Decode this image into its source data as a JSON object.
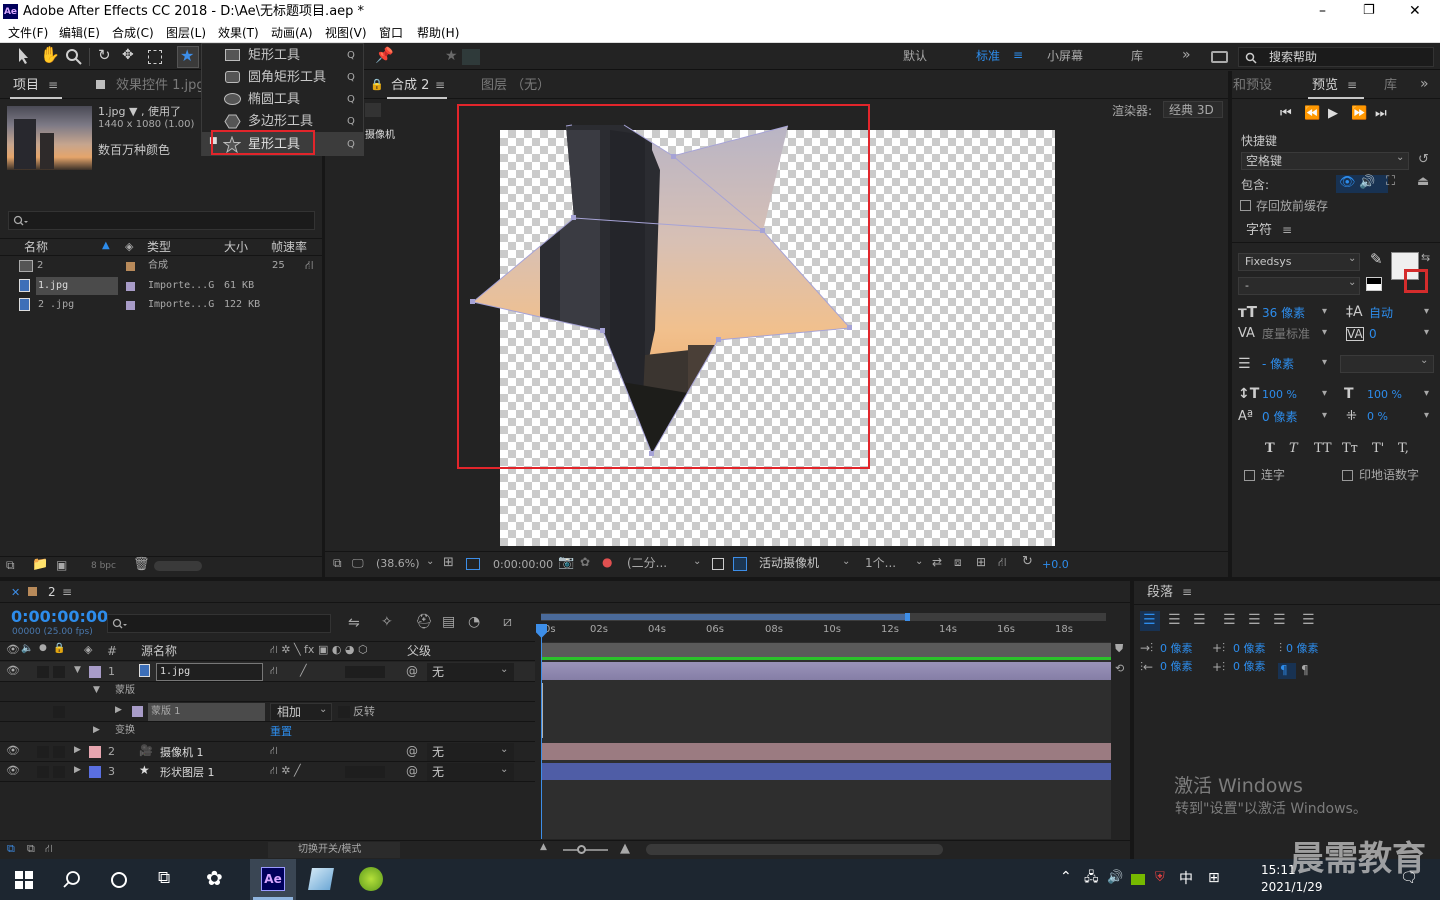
{
  "window": {
    "title": "Adobe After Effects CC 2018 - D:\\Ae\\无标题项目.aep *",
    "app_badge": "Ae",
    "minimize": "–",
    "restore": "❐",
    "close": "✕"
  },
  "menu": [
    "文件(F)",
    "编辑(E)",
    "合成(C)",
    "图层(L)",
    "效果(T)",
    "动画(A)",
    "视图(V)",
    "窗口",
    "帮助(H)"
  ],
  "toolbar": {
    "workspaces": [
      "默认",
      "标准",
      "小屏幕",
      "库"
    ],
    "active_workspace": "标准",
    "more": "»",
    "search_placeholder": "搜索帮助"
  },
  "shape_menu": {
    "items": [
      {
        "label": "矩形工具",
        "shortcut": "Q"
      },
      {
        "label": "圆角矩形工具",
        "shortcut": "Q"
      },
      {
        "label": "椭圆工具",
        "shortcut": "Q"
      },
      {
        "label": "多边形工具",
        "shortcut": "Q"
      },
      {
        "label": "星形工具",
        "shortcut": "Q"
      }
    ],
    "selected": "星形工具"
  },
  "project": {
    "tab_label": "项目",
    "effects_tab": "效果控件 1.jpg",
    "item_name": "1.jpg ▼ , 使用了",
    "item_dims": "1440 x 1080 (1.00)",
    "item_color": "数百万种颜色",
    "search_placeholder": "",
    "columns": [
      "名称",
      "类型",
      "大小",
      "帧速率"
    ],
    "rows": [
      {
        "name": "2",
        "type": "合成",
        "size": "",
        "fps": "25",
        "color": "#b88a5a"
      },
      {
        "name": "1.jpg",
        "type": "Importe...G",
        "size": "61 KB",
        "fps": "",
        "color": "#a89cc8"
      },
      {
        "name": "2 .jpg",
        "type": "Importe...G",
        "size": "122 KB",
        "fps": "",
        "color": "#a89cc8"
      }
    ],
    "bpc": "8 bpc"
  },
  "composition": {
    "tab_label": "合成 2",
    "layer_tab": "图层 （无）",
    "renderer_label": "渲染器:",
    "renderer_value": "经典 3D",
    "camera_label": "摄像机",
    "zoom": "(38.6%)",
    "timecode": "0:00:00:00",
    "resolution": "(二分...",
    "view": "活动摄像机",
    "views_count": "1个...",
    "exposure": "+0.0"
  },
  "preview": {
    "tab1": "和预设",
    "tab2": "预览",
    "tab3": "库",
    "shortcut_label": "快捷键",
    "shortcut_value": "空格键",
    "include_label": "包含:",
    "cache_label": "存回放前缓存"
  },
  "character": {
    "tab": "字符",
    "font": "Fixedsys",
    "style": "-",
    "size": "36 像素",
    "leading": "自动",
    "kerning": "度量标准",
    "tracking": "0",
    "stroke_unit": "- 像素",
    "vscale": "100 %",
    "hscale": "100 %",
    "baseline": "0 像素",
    "tsume": "0 %",
    "styles": [
      "T",
      "T",
      "TT",
      "Tт",
      "T'",
      "T,"
    ],
    "ligatures": "连字",
    "hindi_digits": "印地语数字"
  },
  "paragraph": {
    "tab": "段落",
    "indent_left": "0 像素",
    "indent_right": "0 像素",
    "space_before": "0 像素",
    "first_line": "0 像素",
    "space_after": "0 像素"
  },
  "timeline": {
    "tab": "2",
    "timecode": "0:00:00:00",
    "frame_info": "00000 (25.00 fps)",
    "search_placeholder": "",
    "headers": {
      "num": "#",
      "source": "源名称",
      "parent": "父级"
    },
    "ticks": [
      "0s",
      "02s",
      "04s",
      "06s",
      "08s",
      "10s",
      "12s",
      "14s",
      "16s",
      "18s"
    ],
    "layers": [
      {
        "num": "1",
        "name": "1.jpg",
        "parent": "无",
        "color": "#a89cc8"
      },
      {
        "num": "2",
        "name": "摄像机 1",
        "parent": "无",
        "color": "#e7a6b0"
      },
      {
        "num": "3",
        "name": "形状图层 1",
        "parent": "无",
        "color": "#5a6fe0"
      }
    ],
    "mask_group": "蒙版",
    "mask_name": "蒙版 1",
    "mask_mode": "相加",
    "mask_invert": "反转",
    "transform": "变换",
    "reset": "重置",
    "toggle_label": "切换开关/模式"
  },
  "watermark": {
    "line1": "激活 Windows",
    "line2": "转到\"设置\"以激活 Windows。",
    "brand": "晨需教育"
  },
  "taskbar": {
    "time": "15:11",
    "date": "2021/1/29",
    "ime": "中",
    "ae_label": "Ae"
  }
}
